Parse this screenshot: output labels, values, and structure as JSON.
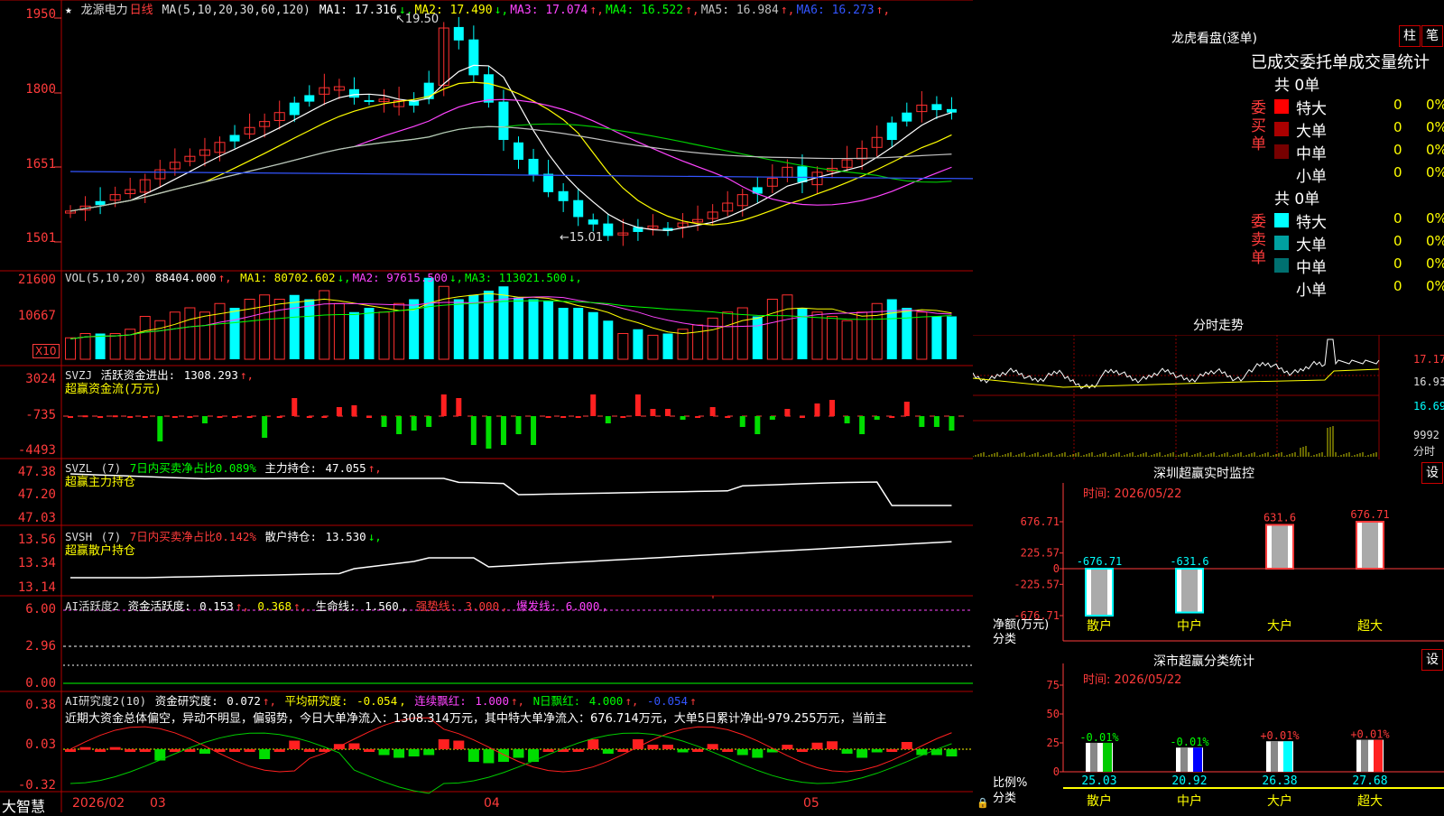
{
  "stock": {
    "name": "龙源电力",
    "period": "日线",
    "ma_params": "MA(5,10,20,30,60,120)",
    "ma_values": [
      {
        "label": "MA1:",
        "value": "17.316",
        "arrow": "↓",
        "color": "#ffffff"
      },
      {
        "label": "MA2:",
        "value": "17.490",
        "arrow": "↓",
        "color": "#ffff00"
      },
      {
        "label": "MA3:",
        "value": "17.074",
        "arrow": "↑",
        "color": "#ff44ff"
      },
      {
        "label": "MA4:",
        "value": "16.522",
        "arrow": "↑",
        "color": "#00ff00"
      },
      {
        "label": "MA5:",
        "value": "16.984",
        "arrow": "↑",
        "color": "#c0c0c0"
      },
      {
        "label": "MA6:",
        "value": "16.273",
        "arrow": "↑",
        "color": "#3355ff"
      }
    ],
    "high_mark": "19.50",
    "low_mark": "15.01",
    "price_axis": [
      "1950",
      "1800",
      "1651",
      "1501"
    ]
  },
  "volume": {
    "params": "VOL(5,10,20)",
    "value": "88404.000",
    "ma": [
      {
        "label": "MA1:",
        "value": "80702.602",
        "arrow": "↓",
        "color": "#ffff00"
      },
      {
        "label": "MA2:",
        "value": "97615.500",
        "arrow": "↓",
        "color": "#ff44ff"
      },
      {
        "label": "MA3:",
        "value": "113021.500",
        "arrow": "↓",
        "color": "#00ff00"
      }
    ],
    "axis": [
      "21600",
      "10667"
    ],
    "unit": "X10"
  },
  "svzj": {
    "name": "SVZJ",
    "title": "活跃资金进出:",
    "value": "1308.293",
    "subtitle": "超赢资金流(万元)",
    "axis": [
      "3024",
      "-735",
      "-4493"
    ]
  },
  "svzl": {
    "name": "SVZL",
    "param": "(7)",
    "desc": "7日内买卖净占比0.089%",
    "hold_label": "主力持仓:",
    "hold_value": "47.055",
    "subtitle": "超赢主力持仓",
    "axis": [
      "47.38",
      "47.20",
      "47.03"
    ]
  },
  "svsh": {
    "name": "SVSH",
    "param": "(7)",
    "desc": "7日内买卖净占比0.142%",
    "hold_label": "散户持仓:",
    "hold_value": "13.530",
    "subtitle": "超赢散户持仓",
    "axis": [
      "13.56",
      "13.34",
      "13.14"
    ]
  },
  "ai_active": {
    "title": "AI活跃度2",
    "item1_label": "资金活跃度:",
    "item1_value": "0.153",
    "item2_value": "0.368",
    "item3_label": "生命线:",
    "item3_value": "1.560",
    "item4_label": "强势线:",
    "item4_value": "3.000",
    "item5_label": "爆发线:",
    "item5_value": "6.000",
    "axis": [
      "6.00",
      "2.96",
      "0.00"
    ]
  },
  "ai_research": {
    "title": "AI研究度2(10)",
    "item1_label": "资金研究度:",
    "item1_value": "0.072",
    "item2_label": "平均研究度:",
    "item2_value": "-0.054",
    "item3_label": "连续飘红:",
    "item3_value": "1.000",
    "item4_label": "N日飘红:",
    "item4_value": "4.000",
    "item5_value": "-0.054",
    "commentary": "近期大资金总体偏空，异动不明显，偏弱势，今日大单净流入：1308.314万元，其中特大单净流入：676.714万元，大单5日累计净出-979.255万元，当前主",
    "axis": [
      "0.38",
      "0.03",
      "-0.32"
    ]
  },
  "bottom_bar": {
    "brand": "大智慧",
    "dates": [
      "2026/02",
      "03",
      "04",
      "05"
    ]
  },
  "dragon": {
    "title": "龙虎看盘(逐单)",
    "tab1": "柱",
    "tab2": "笔",
    "header": "已成交委托单成交量统计",
    "buy_label": "委买单",
    "sell_label": "委卖单",
    "buy_total": "共 0单",
    "sell_total": "共 0单",
    "buy_rows": [
      {
        "name": "特大",
        "count": "0",
        "pct": "0%",
        "color": "#ff0000"
      },
      {
        "name": "大单",
        "count": "0",
        "pct": "0%",
        "color": "#aa0000"
      },
      {
        "name": "中单",
        "count": "0",
        "pct": "0%",
        "color": "#770000"
      },
      {
        "name": "小单",
        "count": "0",
        "pct": "0%",
        "color": "#000000"
      }
    ],
    "sell_rows": [
      {
        "name": "特大",
        "count": "0",
        "pct": "0%",
        "color": "#00ffff"
      },
      {
        "name": "大单",
        "count": "0",
        "pct": "0%",
        "color": "#00a0a0"
      },
      {
        "name": "中单",
        "count": "0",
        "pct": "0%",
        "color": "#007070"
      },
      {
        "name": "小单",
        "count": "0",
        "pct": "0%",
        "color": "#000000"
      }
    ]
  },
  "intraday": {
    "title": "分时走势",
    "p1": "17.17",
    "p2": "16.93",
    "p3": "16.69",
    "vol": "9992",
    "unit": "分时"
  },
  "sz_monitor": {
    "title": "深圳超赢实时监控",
    "settings": "设",
    "time": "时间: 2026/05/22",
    "axis": [
      "676.71",
      "225.57",
      "0",
      "-225.57",
      "-676.71"
    ],
    "y_label": "净额(万元)",
    "x_label": "分类",
    "bars": [
      {
        "name": "散户",
        "value": -676.71,
        "label": "-676.71"
      },
      {
        "name": "中户",
        "value": -631.6,
        "label": "-631.6"
      },
      {
        "name": "大户",
        "value": 631.6,
        "label": "631.6"
      },
      {
        "name": "超大",
        "value": 676.71,
        "label": "676.71"
      }
    ]
  },
  "sz_class": {
    "title": "深市超赢分类统计",
    "settings": "设",
    "time": "时间: 2026/05/22",
    "axis": [
      "75",
      "50",
      "25",
      "0"
    ],
    "y_label": "比例%",
    "x_label": "分类",
    "bars": [
      {
        "name": "散户",
        "value": 25.03,
        "label": "25.03",
        "delta": "-0.01%",
        "color": "#00cc00"
      },
      {
        "name": "中户",
        "value": 20.92,
        "label": "20.92",
        "delta": "-0.01%",
        "color": "#0000ff"
      },
      {
        "name": "大户",
        "value": 26.38,
        "label": "26.38",
        "delta": "+0.01%",
        "color": "#00ffff"
      },
      {
        "name": "超大",
        "value": 27.68,
        "label": "27.68",
        "delta": "+0.01%",
        "color": "#ff2222"
      }
    ]
  }
}
